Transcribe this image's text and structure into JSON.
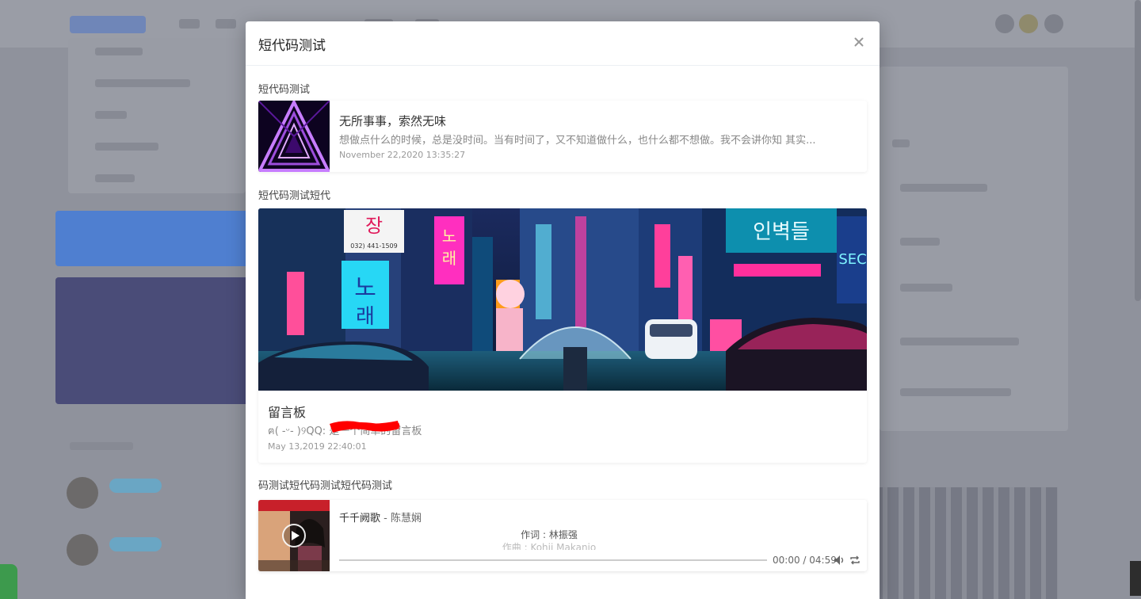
{
  "modal": {
    "title": "短代码测试",
    "close_label": "×"
  },
  "sections": {
    "first_label": "短代码测试",
    "second_label": "短代码测试短代",
    "third_label": "码测试短代码测试短代码测试"
  },
  "post_card": {
    "title": "无所事事，索然无味",
    "excerpt": "想做点什么的时候，总是没时间。当有时间了，又不知道做什么，也什么都不想做。我不会讲你知 其实...",
    "date": "November 22,2020 13:35:27"
  },
  "guestbook_card": {
    "title": "留言板",
    "description": "ฅ( -ᵕ- )୨QQ:            是一个简单的留言板",
    "date": "May 13,2019 22:40:01"
  },
  "music_player": {
    "title": "千千阙歌",
    "artist": " - 陈慧娴",
    "lyric_line_1": "作词 : 林振强",
    "lyric_line_2": "作曲 : Kohji Makanio",
    "time": "00:00 / 04:59",
    "progress": 0,
    "icons": [
      "play-icon",
      "volume-icon",
      "loop-icon"
    ]
  },
  "colors": {
    "overlay": "#8f929c",
    "modal_bg": "#ffffff",
    "redaction": "#ff0000"
  }
}
